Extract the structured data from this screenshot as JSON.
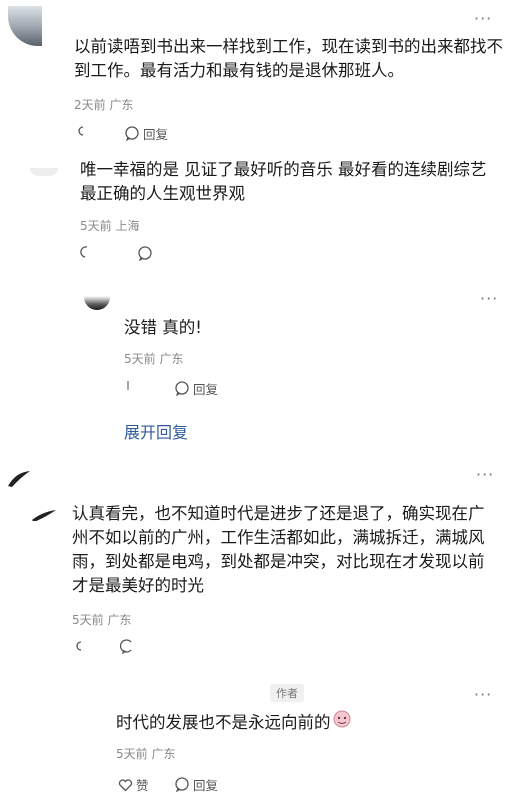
{
  "comments": [
    {
      "text": "以前读唔到书出来一样找到工作，现在读到书的出来都找不到工作。最有活力和最有钱的是退休那班人。",
      "time": "2天前",
      "location": "广东",
      "reply_label": "回复"
    },
    {
      "text": "唯一幸福的是 见证了最好听的音乐 最好看的连续剧综艺 最正确的人生观世界观",
      "time": "5天前",
      "location": "上海",
      "reply_label": ""
    },
    {
      "text": "没错 真的!",
      "time": "5天前",
      "location": "广东",
      "reply_label": "回复"
    },
    {
      "text": "认真看完，也不知道时代是进步了还是退了，确实现在广州不如以前的广州，工作生活都如此，满城拆迁，满城风雨，到处都是电鸡，到处都是冲突，对比现在才发现以前才是最美好的时光",
      "time": "5天前",
      "location": "广东",
      "reply_label": ""
    },
    {
      "text": "时代的发展也不是永远向前的",
      "time": "5天前",
      "location": "广东",
      "reply_label": "回复",
      "like_label": "赞",
      "badge": "作者"
    }
  ],
  "expand_link": "展开回复",
  "more_glyph": "···",
  "colors": {
    "link": "#2f5b9b",
    "meta": "#8a8a8a"
  }
}
